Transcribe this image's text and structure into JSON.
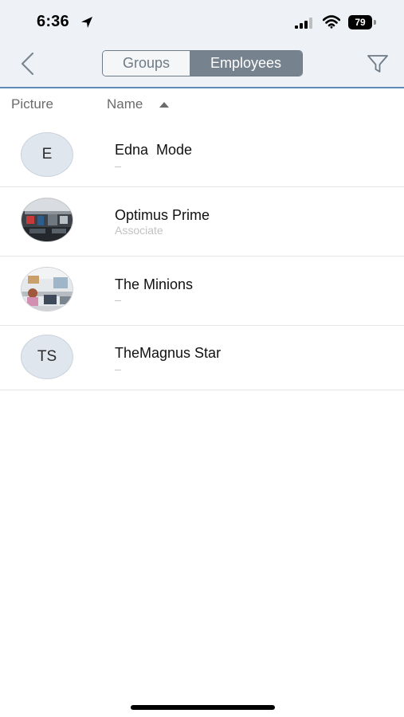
{
  "status_bar": {
    "time": "6:36",
    "battery": "79"
  },
  "nav": {
    "segments": [
      "Groups",
      "Employees"
    ],
    "selected_segment": "Employees"
  },
  "columns": {
    "picture": "Picture",
    "name": "Name",
    "sort": "ascending"
  },
  "employees": [
    {
      "name": "Edna  Mode",
      "subtitle": "–",
      "avatar": "initials",
      "initials": "E"
    },
    {
      "name": "Optimus Prime",
      "subtitle": "Associate",
      "avatar": "photo"
    },
    {
      "name": "The Minions",
      "subtitle": "–",
      "avatar": "photo"
    },
    {
      "name": "TheMagnus Star",
      "subtitle": "–",
      "avatar": "initials",
      "initials": "TS"
    }
  ],
  "colors": {
    "header_bg": "#eef2f7",
    "accent_line": "#5a8ab5",
    "segment_selected": "#76828d"
  },
  "icons": [
    "location-arrow-icon",
    "cellular-signal-icon",
    "wifi-icon",
    "battery-icon",
    "back-chevron-icon",
    "filter-icon",
    "sort-up-icon"
  ]
}
